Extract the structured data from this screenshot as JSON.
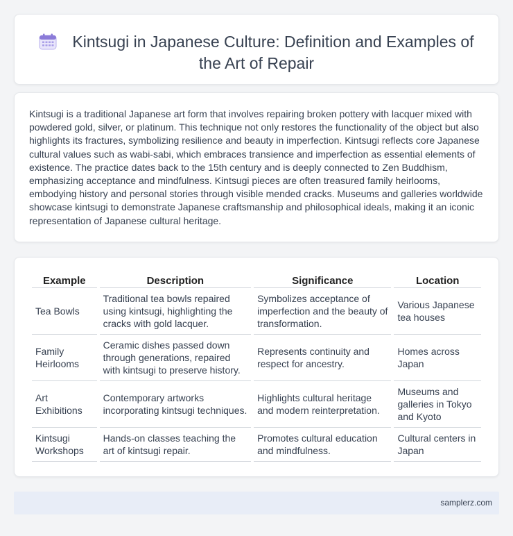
{
  "header": {
    "icon": "calendar-icon",
    "title": "Kintsugi in Japanese Culture: Definition and Examples of the Art of Repair"
  },
  "intro": {
    "text": "Kintsugi is a traditional Japanese art form that involves repairing broken pottery with lacquer mixed with powdered gold, silver, or platinum. This technique not only restores the functionality of the object but also highlights its fractures, symbolizing resilience and beauty in imperfection. Kintsugi reflects core Japanese cultural values such as wabi-sabi, which embraces transience and imperfection as essential elements of existence. The practice dates back to the 15th century and is deeply connected to Zen Buddhism, emphasizing acceptance and mindfulness. Kintsugi pieces are often treasured family heirlooms, embodying history and personal stories through visible mended cracks. Museums and galleries worldwide showcase kintsugi to demonstrate Japanese craftsmanship and philosophical ideals, making it an iconic representation of Japanese cultural heritage."
  },
  "table": {
    "headers": [
      "Example",
      "Description",
      "Significance",
      "Location"
    ],
    "rows": [
      [
        "Tea Bowls",
        "Traditional tea bowls repaired using kintsugi, highlighting the cracks with gold lacquer.",
        "Symbolizes acceptance of imperfection and the beauty of transformation.",
        "Various Japanese tea houses"
      ],
      [
        "Family Heirlooms",
        "Ceramic dishes passed down through generations, repaired with kintsugi to preserve history.",
        "Represents continuity and respect for ancestry.",
        "Homes across Japan"
      ],
      [
        "Art Exhibitions",
        "Contemporary artworks incorporating kintsugi techniques.",
        "Highlights cultural heritage and modern reinterpretation.",
        "Museums and galleries in Tokyo and Kyoto"
      ],
      [
        "Kintsugi Workshops",
        "Hands-on classes teaching the art of kintsugi repair.",
        "Promotes cultural education and mindfulness.",
        "Cultural centers in Japan"
      ]
    ]
  },
  "footer": {
    "site": "samplerz.com"
  },
  "colors": {
    "background": "#f3f4f6",
    "card": "#ffffff",
    "footer": "#e8edf7",
    "icon_accent": "#8b7bd8"
  }
}
